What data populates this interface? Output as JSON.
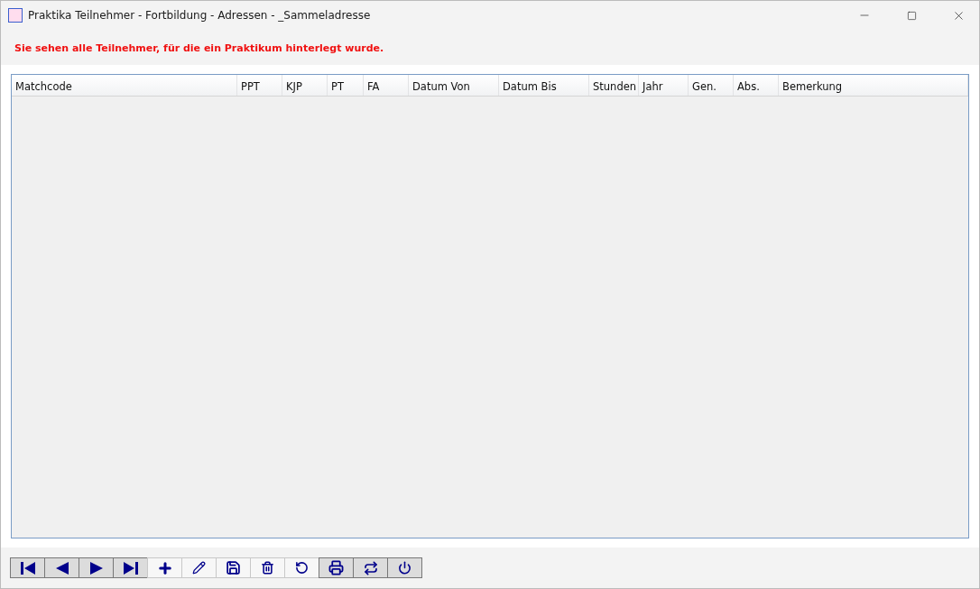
{
  "window": {
    "title": "Praktika Teilnehmer - Fortbildung - Adressen - _Sammeladresse"
  },
  "info_message": "Sie sehen alle Teilnehmer, für die ein Praktikum hinterlegt wurde.",
  "table": {
    "columns": [
      {
        "label": "Matchcode"
      },
      {
        "label": "PPT"
      },
      {
        "label": "KJP"
      },
      {
        "label": "PT"
      },
      {
        "label": "FA"
      },
      {
        "label": "Datum Von"
      },
      {
        "label": "Datum Bis"
      },
      {
        "label": "Stunden"
      },
      {
        "label": "Jahr"
      },
      {
        "label": "Gen."
      },
      {
        "label": "Abs."
      },
      {
        "label": "Bemerkung"
      }
    ]
  },
  "toolbar": [
    {
      "kind": "first",
      "disabled": false
    },
    {
      "kind": "previous",
      "disabled": false
    },
    {
      "kind": "next",
      "disabled": false
    },
    {
      "kind": "last",
      "disabled": false
    },
    {
      "kind": "add",
      "disabled": true
    },
    {
      "kind": "edit",
      "disabled": true
    },
    {
      "kind": "save",
      "disabled": true
    },
    {
      "kind": "delete",
      "disabled": true
    },
    {
      "kind": "undo",
      "disabled": true
    },
    {
      "kind": "print",
      "disabled": false
    },
    {
      "kind": "swap",
      "disabled": false
    },
    {
      "kind": "power",
      "disabled": false
    }
  ]
}
